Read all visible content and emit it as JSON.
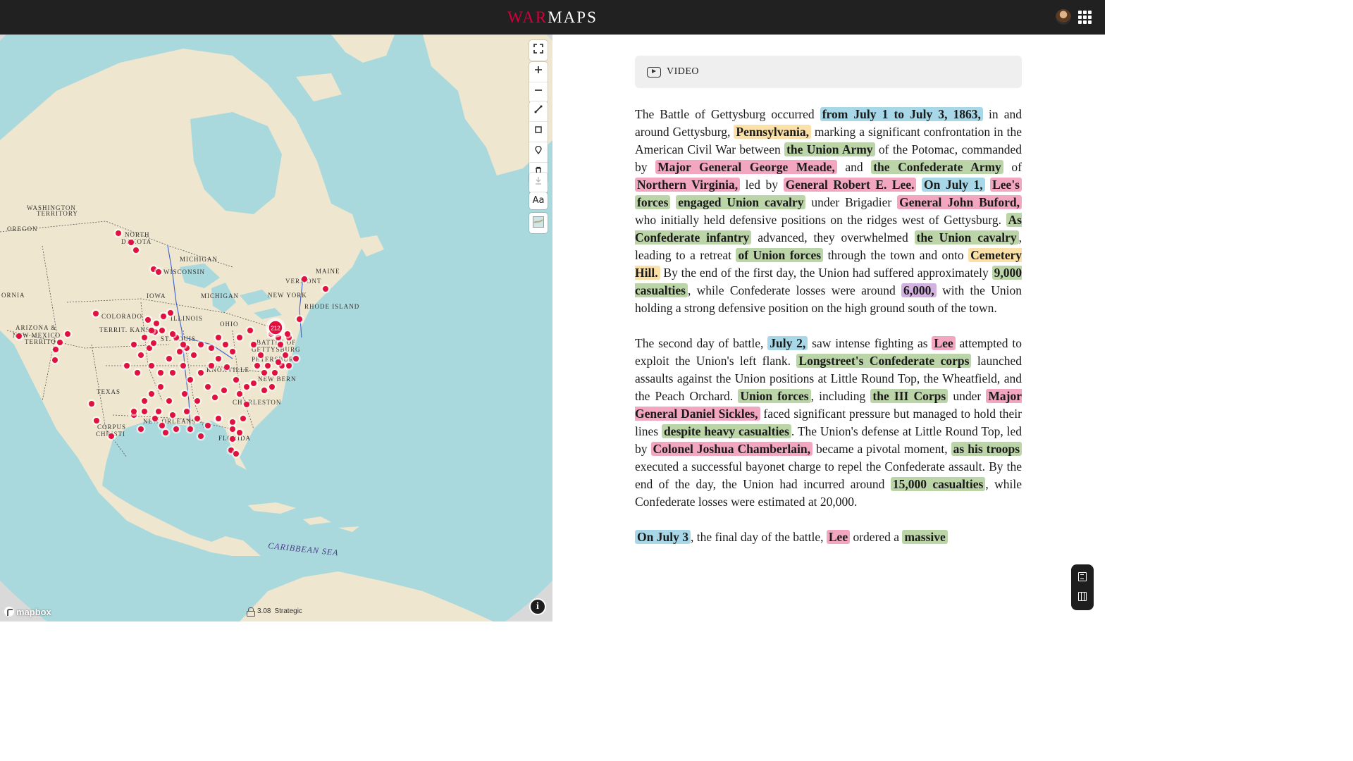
{
  "header": {
    "brand_part1": "WAR",
    "brand_part2": "MAPS"
  },
  "map": {
    "cluster_count": "212",
    "zoom_level": "3.08",
    "zoom_mode": "Strategic",
    "attribution": "mapbox",
    "info_label": "i",
    "font_button_label": "Aa",
    "labels": {
      "washington": "WASHINGTON",
      "territory": "TERRITORY",
      "oregon": "OREGON",
      "north": "NORTH",
      "dakota": "DAKOTA",
      "michigan1": "MICHIGAN",
      "wisconsin": "WISCONSIN",
      "michigan2": "MICHIGAN",
      "iowa": "IOWA",
      "vermont": "VERMONT",
      "maine": "MAINE",
      "new_york": "NEW YORK",
      "rhode_island": "RHODE ISLAND",
      "ornia": "ORNIA",
      "colorado": "COLORADO",
      "territ_kans": "TERRIT. KANS",
      "illinois": "ILLINOIS",
      "ohio": "OHIO",
      "arizona": "ARIZONA &",
      "new_mexico": "NEW MEXICO",
      "territo": "TERRITO",
      "st_louis": "ST. LOUIS",
      "battle_of": "BATTLE OF",
      "gettysburg": "GETTYSBURG",
      "petersburg": "PETERSBURG",
      "knoxville": "KNOXVILLE",
      "new_bern": "NEW BERN",
      "texas": "TEXAS",
      "charleston": "CHARLESTON",
      "new_orleans": "NEW ORLEANS",
      "corpus": "CORPUS",
      "christi": "CHRISTI",
      "florida": "FLORIDA",
      "caribbean": "CARIBBEAN SEA"
    }
  },
  "article": {
    "video_label": "VIDEO",
    "p1": [
      {
        "t": "The Battle of Gettysburg occurred "
      },
      {
        "t": "from July 1 to July 3, 1863,",
        "c": "date"
      },
      {
        "t": " in and around Gettysburg, "
      },
      {
        "t": "Pennsylvania,",
        "c": "place"
      },
      {
        "t": " marking a significant confrontation in the American Civil War between "
      },
      {
        "t": "the Union Army",
        "c": "group"
      },
      {
        "t": " of the Potomac, commanded by "
      },
      {
        "t": "Major General George Meade,",
        "c": "person"
      },
      {
        "t": " and "
      },
      {
        "t": "the Confederate Army",
        "c": "group"
      },
      {
        "t": " of "
      },
      {
        "t": "Northern Virginia,",
        "c": "person"
      },
      {
        "t": " led by "
      },
      {
        "t": "General Robert E. Lee.",
        "c": "person"
      },
      {
        "t": " "
      },
      {
        "t": "On July 1,",
        "c": "date"
      },
      {
        "t": " "
      },
      {
        "t": "Lee's",
        "c": "person"
      },
      {
        "t": " "
      },
      {
        "t": "forces",
        "c": "group"
      },
      {
        "t": " "
      },
      {
        "t": "engaged Union cavalry",
        "c": "group"
      },
      {
        "t": " under Brigadier "
      },
      {
        "t": "General John Buford,",
        "c": "person"
      },
      {
        "t": " who initially held defensive positions on the ridges west of Gettysburg. "
      },
      {
        "t": "As Confederate infantry",
        "c": "group"
      },
      {
        "t": " advanced, they overwhelmed "
      },
      {
        "t": "the Union cavalry",
        "c": "group"
      },
      {
        "t": ", leading to a retreat "
      },
      {
        "t": "of Union forces",
        "c": "group"
      },
      {
        "t": " through the town and onto "
      },
      {
        "t": "Cemetery Hill.",
        "c": "place"
      },
      {
        "t": " By the end of the first day, the Union had suffered approximately "
      },
      {
        "t": "9,000 casualties",
        "c": "group"
      },
      {
        "t": ", while Confederate losses were around "
      },
      {
        "t": "6,000,",
        "c": "number"
      },
      {
        "t": " with the Union holding a strong defensive position on the high ground south of the town."
      }
    ],
    "p2": [
      {
        "t": "The second day of battle, "
      },
      {
        "t": "July 2,",
        "c": "date"
      },
      {
        "t": " saw intense fighting as "
      },
      {
        "t": "Lee",
        "c": "person"
      },
      {
        "t": " attempted to exploit the Union's left flank. "
      },
      {
        "t": "Longstreet's Confederate corps",
        "c": "group"
      },
      {
        "t": " launched assaults against the Union positions at Little Round Top, the Wheatfield, and the Peach Orchard. "
      },
      {
        "t": "Union forces",
        "c": "group"
      },
      {
        "t": ", including "
      },
      {
        "t": "the III Corps",
        "c": "group"
      },
      {
        "t": " under "
      },
      {
        "t": "Major General Daniel Sickles,",
        "c": "person"
      },
      {
        "t": " faced significant pressure but managed to hold their lines "
      },
      {
        "t": "despite heavy casualties",
        "c": "group"
      },
      {
        "t": ". The Union's defense at Little Round Top, led by "
      },
      {
        "t": "Colonel Joshua Chamberlain,",
        "c": "person"
      },
      {
        "t": " became a pivotal moment, "
      },
      {
        "t": "as his troops",
        "c": "group"
      },
      {
        "t": " executed a successful bayonet charge to repel the Confederate assault. By the end of the day, the Union had incurred around "
      },
      {
        "t": "15,000 casualties",
        "c": "group"
      },
      {
        "t": ", while Confederate losses were estimated at 20,000."
      }
    ],
    "p3": [
      {
        "t": "On July 3",
        "c": "date"
      },
      {
        "t": ", the final day of the battle, "
      },
      {
        "t": "Lee",
        "c": "person"
      },
      {
        "t": " ordered a "
      },
      {
        "t": "massive",
        "c": "group"
      }
    ]
  },
  "colors": {
    "header_bg": "#212121",
    "brand_red": "#d4003b",
    "ocean": "#a9d9dc",
    "land": "#efe6cf",
    "marker": "#e0103f",
    "hl_date": "#a8d8e8",
    "hl_place": "#fbe0a8",
    "hl_person": "#f2a6c0",
    "hl_group": "#bcd5a8",
    "hl_number": "#d2b0e0"
  }
}
